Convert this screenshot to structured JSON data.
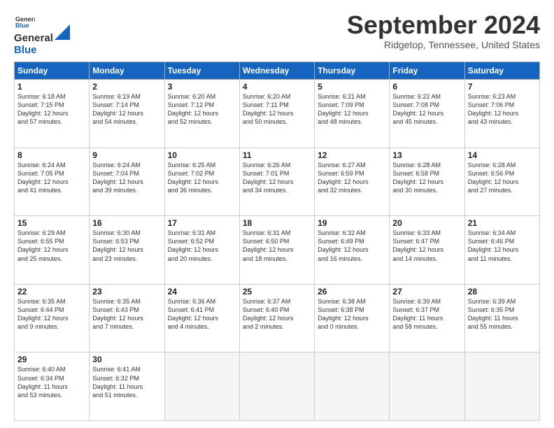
{
  "logo": {
    "line1": "General",
    "line2": "Blue"
  },
  "title": "September 2024",
  "location": "Ridgetop, Tennessee, United States",
  "headers": [
    "Sunday",
    "Monday",
    "Tuesday",
    "Wednesday",
    "Thursday",
    "Friday",
    "Saturday"
  ],
  "weeks": [
    [
      {
        "day": "1",
        "info": "Sunrise: 6:18 AM\nSunset: 7:15 PM\nDaylight: 12 hours\nand 57 minutes."
      },
      {
        "day": "2",
        "info": "Sunrise: 6:19 AM\nSunset: 7:14 PM\nDaylight: 12 hours\nand 54 minutes."
      },
      {
        "day": "3",
        "info": "Sunrise: 6:20 AM\nSunset: 7:12 PM\nDaylight: 12 hours\nand 52 minutes."
      },
      {
        "day": "4",
        "info": "Sunrise: 6:20 AM\nSunset: 7:11 PM\nDaylight: 12 hours\nand 50 minutes."
      },
      {
        "day": "5",
        "info": "Sunrise: 6:21 AM\nSunset: 7:09 PM\nDaylight: 12 hours\nand 48 minutes."
      },
      {
        "day": "6",
        "info": "Sunrise: 6:22 AM\nSunset: 7:08 PM\nDaylight: 12 hours\nand 45 minutes."
      },
      {
        "day": "7",
        "info": "Sunrise: 6:23 AM\nSunset: 7:06 PM\nDaylight: 12 hours\nand 43 minutes."
      }
    ],
    [
      {
        "day": "8",
        "info": "Sunrise: 6:24 AM\nSunset: 7:05 PM\nDaylight: 12 hours\nand 41 minutes."
      },
      {
        "day": "9",
        "info": "Sunrise: 6:24 AM\nSunset: 7:04 PM\nDaylight: 12 hours\nand 39 minutes."
      },
      {
        "day": "10",
        "info": "Sunrise: 6:25 AM\nSunset: 7:02 PM\nDaylight: 12 hours\nand 36 minutes."
      },
      {
        "day": "11",
        "info": "Sunrise: 6:26 AM\nSunset: 7:01 PM\nDaylight: 12 hours\nand 34 minutes."
      },
      {
        "day": "12",
        "info": "Sunrise: 6:27 AM\nSunset: 6:59 PM\nDaylight: 12 hours\nand 32 minutes."
      },
      {
        "day": "13",
        "info": "Sunrise: 6:28 AM\nSunset: 6:58 PM\nDaylight: 12 hours\nand 30 minutes."
      },
      {
        "day": "14",
        "info": "Sunrise: 6:28 AM\nSunset: 6:56 PM\nDaylight: 12 hours\nand 27 minutes."
      }
    ],
    [
      {
        "day": "15",
        "info": "Sunrise: 6:29 AM\nSunset: 6:55 PM\nDaylight: 12 hours\nand 25 minutes."
      },
      {
        "day": "16",
        "info": "Sunrise: 6:30 AM\nSunset: 6:53 PM\nDaylight: 12 hours\nand 23 minutes."
      },
      {
        "day": "17",
        "info": "Sunrise: 6:31 AM\nSunset: 6:52 PM\nDaylight: 12 hours\nand 20 minutes."
      },
      {
        "day": "18",
        "info": "Sunrise: 6:31 AM\nSunset: 6:50 PM\nDaylight: 12 hours\nand 18 minutes."
      },
      {
        "day": "19",
        "info": "Sunrise: 6:32 AM\nSunset: 6:49 PM\nDaylight: 12 hours\nand 16 minutes."
      },
      {
        "day": "20",
        "info": "Sunrise: 6:33 AM\nSunset: 6:47 PM\nDaylight: 12 hours\nand 14 minutes."
      },
      {
        "day": "21",
        "info": "Sunrise: 6:34 AM\nSunset: 6:46 PM\nDaylight: 12 hours\nand 11 minutes."
      }
    ],
    [
      {
        "day": "22",
        "info": "Sunrise: 6:35 AM\nSunset: 6:44 PM\nDaylight: 12 hours\nand 9 minutes."
      },
      {
        "day": "23",
        "info": "Sunrise: 6:35 AM\nSunset: 6:43 PM\nDaylight: 12 hours\nand 7 minutes."
      },
      {
        "day": "24",
        "info": "Sunrise: 6:36 AM\nSunset: 6:41 PM\nDaylight: 12 hours\nand 4 minutes."
      },
      {
        "day": "25",
        "info": "Sunrise: 6:37 AM\nSunset: 6:40 PM\nDaylight: 12 hours\nand 2 minutes."
      },
      {
        "day": "26",
        "info": "Sunrise: 6:38 AM\nSunset: 6:38 PM\nDaylight: 12 hours\nand 0 minutes."
      },
      {
        "day": "27",
        "info": "Sunrise: 6:39 AM\nSunset: 6:37 PM\nDaylight: 11 hours\nand 58 minutes."
      },
      {
        "day": "28",
        "info": "Sunrise: 6:39 AM\nSunset: 6:35 PM\nDaylight: 11 hours\nand 55 minutes."
      }
    ],
    [
      {
        "day": "29",
        "info": "Sunrise: 6:40 AM\nSunset: 6:34 PM\nDaylight: 11 hours\nand 53 minutes."
      },
      {
        "day": "30",
        "info": "Sunrise: 6:41 AM\nSunset: 6:32 PM\nDaylight: 11 hours\nand 51 minutes."
      },
      {
        "day": "",
        "info": ""
      },
      {
        "day": "",
        "info": ""
      },
      {
        "day": "",
        "info": ""
      },
      {
        "day": "",
        "info": ""
      },
      {
        "day": "",
        "info": ""
      }
    ]
  ]
}
